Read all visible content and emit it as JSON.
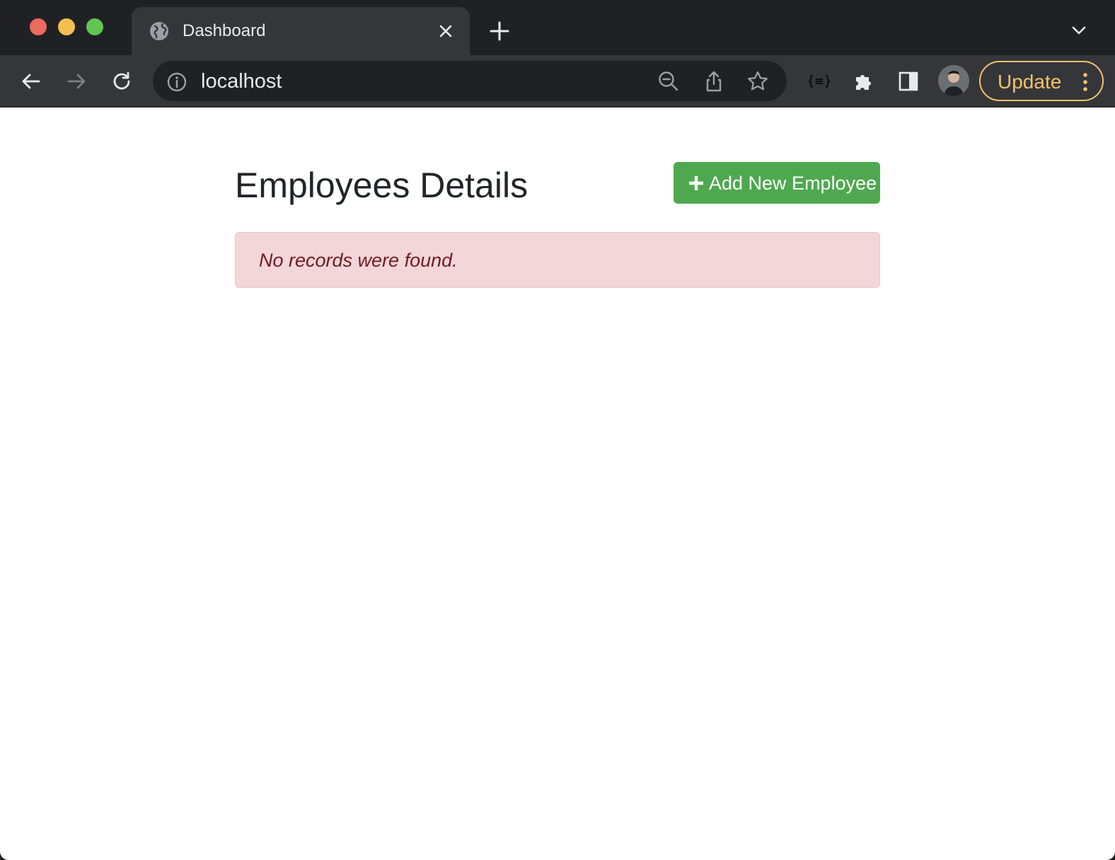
{
  "browser": {
    "tab": {
      "title": "Dashboard"
    },
    "address_bar": {
      "url": "localhost"
    },
    "update_button": {
      "label": "Update"
    },
    "colors": {
      "update_accent": "#f6c26b"
    }
  },
  "page": {
    "title": "Employees Details",
    "add_button": {
      "label": "Add New Employee",
      "color": "#4fa84f"
    },
    "alert": {
      "message": "No records were found.",
      "background": "#f2d6d8",
      "text_color": "#701b22"
    }
  },
  "icons": [
    "globe-icon",
    "close-icon",
    "plus-icon",
    "chevron-down-icon",
    "back-arrow-icon",
    "forward-arrow-icon",
    "reload-icon",
    "info-icon",
    "zoom-out-icon",
    "share-icon",
    "star-icon",
    "json-viewer-icon",
    "puzzle-icon",
    "sidebar-icon",
    "kebab-menu-icon"
  ]
}
